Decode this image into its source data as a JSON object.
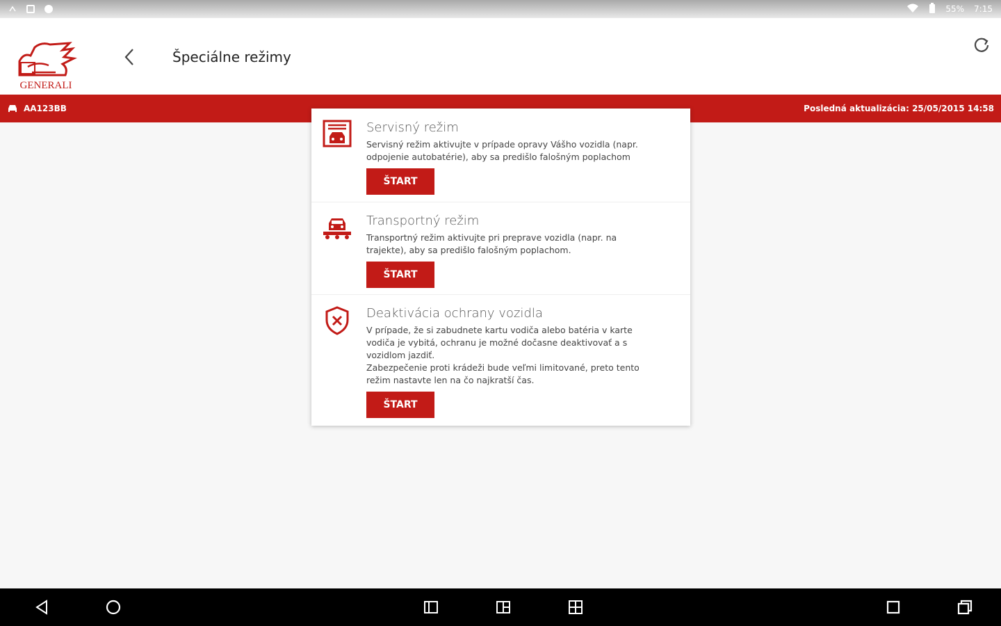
{
  "status_bar": {
    "battery": "55%",
    "time": "7:15"
  },
  "header": {
    "logo_text": "GENERALI",
    "title": "Špeciálne režimy"
  },
  "vehicle_bar": {
    "plate": "AA123BB",
    "last_update": "Posledná aktualizácia: 25/05/2015 14:58"
  },
  "modes": [
    {
      "title": "Servisný režim",
      "description": "Servisný režim aktivujte v prípade opravy Vášho vozidla (napr. odpojenie autobatérie), aby sa predišlo falošným poplachom",
      "button": "ŠTART",
      "icon": "garage-car-icon"
    },
    {
      "title": "Transportný režim",
      "description": "Transportný režim aktivujte pri preprave vozidla (napr. na trajekte), aby sa predišlo falošným poplachom.",
      "button": "ŠTART",
      "icon": "car-transport-icon"
    },
    {
      "title": "Deaktivácia ochrany vozidla",
      "description": "V prípade, že si zabudnete kartu vodiča alebo batéria v karte vodiča je vybitá, ochranu je možné dočasne deaktivovať a s vozidlom jazdiť.",
      "description2": "Zabezpečenie proti krádeži bude veľmi limitované, preto tento režim nastavte len na čo najkratší čas.",
      "button": "ŠTART",
      "icon": "shield-x-icon"
    }
  ],
  "colors": {
    "brand": "#c21b17",
    "background": "#f7f7f7"
  }
}
